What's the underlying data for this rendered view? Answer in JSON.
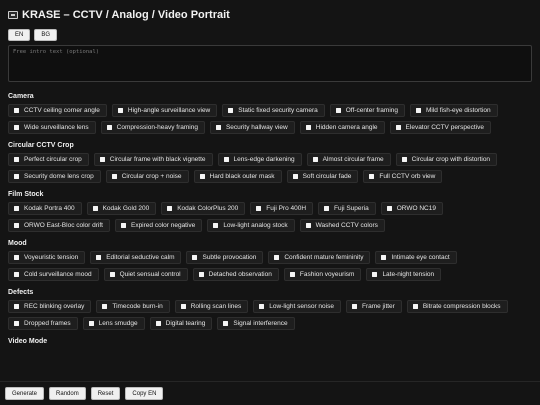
{
  "header": {
    "icon": "video-camera-icon",
    "title": "KRASE – CCTV / Analog / Video Portrait"
  },
  "languages": [
    "EN",
    "BG"
  ],
  "intro": {
    "placeholder": "Free intro text (optional)",
    "value": ""
  },
  "sections": [
    {
      "title": "Camera",
      "items": [
        "CCTV ceiling corner angle",
        "High-angle surveillance view",
        "Static fixed security camera",
        "Off-center framing",
        "Mild fish-eye distortion",
        "Wide surveillance lens",
        "Compression-heavy framing",
        "Security hallway view",
        "Hidden camera angle",
        "Elevator CCTV perspective"
      ]
    },
    {
      "title": "Circular CCTV Crop",
      "items": [
        "Perfect circular crop",
        "Circular frame with black vignette",
        "Lens-edge darkening",
        "Almost circular frame",
        "Circular crop with distortion",
        "Security dome lens crop",
        "Circular crop + noise",
        "Hard black outer mask",
        "Soft circular fade",
        "Full CCTV orb view"
      ]
    },
    {
      "title": "Film Stock",
      "items": [
        "Kodak Portra 400",
        "Kodak Gold 200",
        "Kodak ColorPlus 200",
        "Fuji Pro 400H",
        "Fuji Superia",
        "ORWO NC19",
        "ORWO East-Bloc color drift",
        "Expired color negative",
        "Low-light analog stock",
        "Washed CCTV colors"
      ]
    },
    {
      "title": "Mood",
      "items": [
        "Voyeuristic tension",
        "Editorial seductive calm",
        "Subtle provocation",
        "Confident mature femininity",
        "Intimate eye contact",
        "Cold surveillance mood",
        "Quiet sensual control",
        "Detached observation",
        "Fashion voyeurism",
        "Late-night tension"
      ]
    },
    {
      "title": "Defects",
      "items": [
        "REC blinking overlay",
        "Timecode burn-in",
        "Rolling scan lines",
        "Low-light sensor noise",
        "Frame jitter",
        "Bitrate compression blocks",
        "Dropped frames",
        "Lens smudge",
        "Digital tearing",
        "Signal interference"
      ]
    },
    {
      "title": "Video Mode",
      "items": []
    }
  ],
  "footer": {
    "buttons": [
      "Generate",
      "Random",
      "Reset",
      "Copy EN"
    ]
  }
}
